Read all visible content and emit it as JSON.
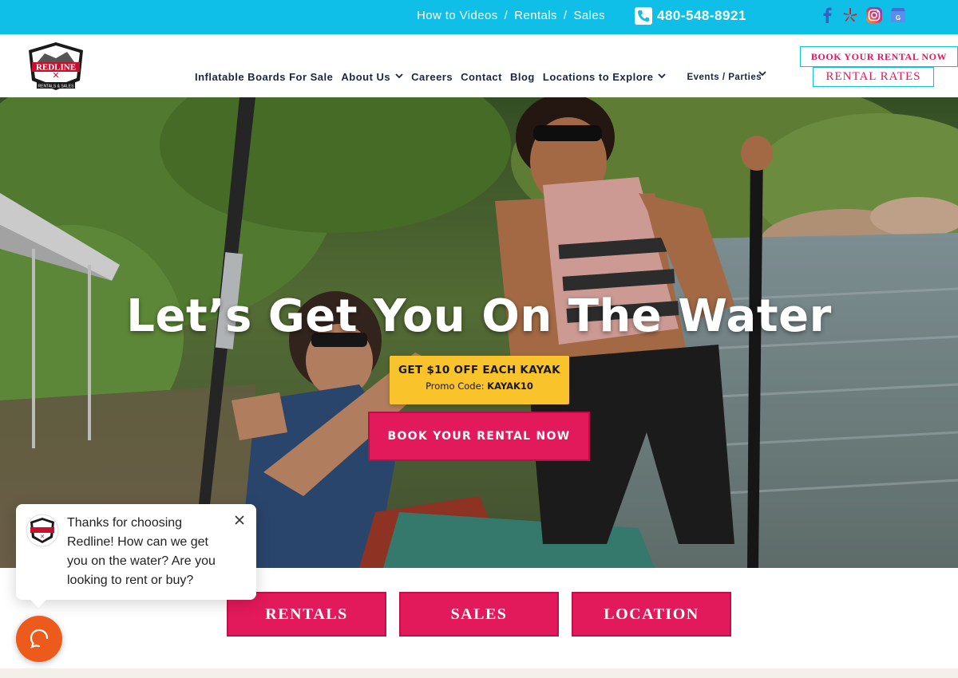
{
  "topbar": {
    "links": [
      "How to Videos",
      "Rentals",
      "Sales"
    ],
    "separator": "/",
    "phone": "480-548-8921",
    "social_icons": [
      "facebook-icon",
      "yelp-icon",
      "instagram-icon",
      "google-business-icon"
    ],
    "bg_color": "#10bfe8"
  },
  "header": {
    "logo_text": "REDLINE",
    "logo_subtext": "RENTALS & SALES",
    "nav": [
      {
        "label": "Inflatable Boards For Sale"
      },
      {
        "label": "About Us",
        "has_dropdown": true
      },
      {
        "label": "Careers"
      },
      {
        "label": "Contact"
      },
      {
        "label": "Blog"
      },
      {
        "label": "Locations to Explore",
        "has_dropdown": true
      },
      {
        "label": "Events / Parties",
        "has_dropdown": true
      }
    ],
    "book_button": "BOOK YOUR RENTAL NOW",
    "rates_button": "RENTAL RATES"
  },
  "hero": {
    "title": "Let’s Get You On The Water",
    "promo_headline": "GET $10 OFF EACH KAYAK",
    "promo_label": "Promo Code:",
    "promo_code": "KAYAK10",
    "book_button": "BOOK YOUR RENTAL NOW"
  },
  "ctas": [
    "RENTALS",
    "SALES",
    "LOCATION"
  ],
  "chat": {
    "message": "Thanks for choosing Redline! How can we get you on the water? Are you looking to rent or buy?",
    "launcher_color": "#ec5a1c"
  },
  "colors": {
    "brand_pink": "#e2195b",
    "promo_yellow": "#f9c32b",
    "accent_cyan": "#10bfe8",
    "nav_text": "#1a2740"
  }
}
